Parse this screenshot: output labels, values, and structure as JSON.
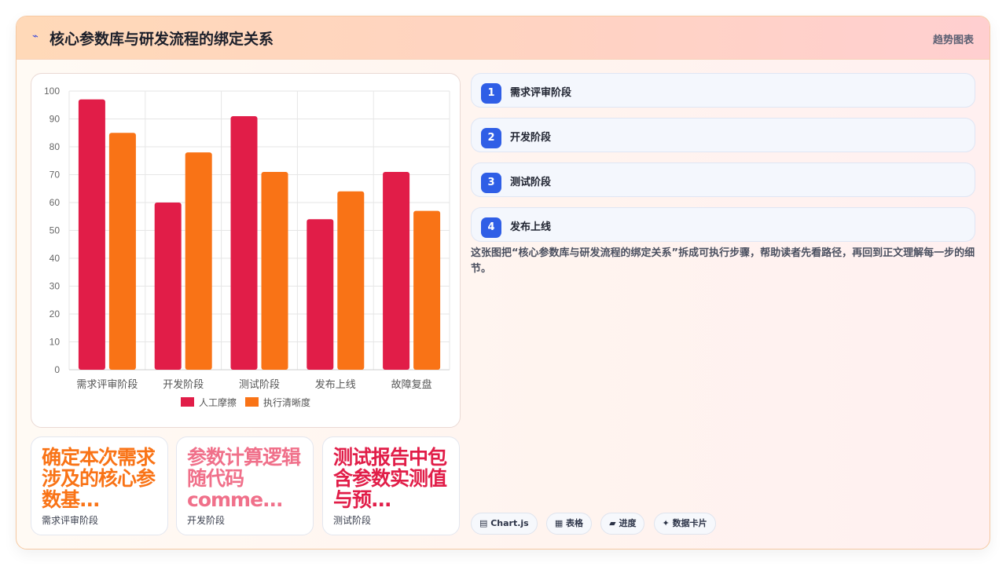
{
  "header": {
    "icon": "trend-icon",
    "title": "核心参数库与研发流程的绑定关系",
    "link_label": "趋势图表"
  },
  "chart_data": {
    "type": "bar",
    "categories": [
      "需求评审阶段",
      "开发阶段",
      "测试阶段",
      "发布上线",
      "故障复盘"
    ],
    "series": [
      {
        "name": "人工摩擦",
        "color": "#e11d48",
        "values": [
          97,
          60,
          91,
          54,
          71
        ]
      },
      {
        "name": "执行清晰度",
        "color": "#f97316",
        "values": [
          85,
          78,
          71,
          64,
          57
        ]
      }
    ],
    "ylim": [
      0,
      100
    ],
    "yticks": [
      0,
      10,
      20,
      30,
      40,
      50,
      60,
      70,
      80,
      90,
      100
    ],
    "grid": true,
    "legend_position": "bottom"
  },
  "steps": [
    {
      "num": "1",
      "label": "需求评审阶段"
    },
    {
      "num": "2",
      "label": "开发阶段"
    },
    {
      "num": "3",
      "label": "测试阶段"
    },
    {
      "num": "4",
      "label": "发布上线"
    }
  ],
  "description": "这张图把“核心参数库与研发流程的绑定关系”拆成可执行步骤，帮助读者先看路径，再回到正文理解每一步的细节。",
  "tags": [
    {
      "icon": "chart-icon",
      "label": "▤ Chart.js"
    },
    {
      "icon": "table-icon",
      "label": "▦ 表格"
    },
    {
      "icon": "progress-icon",
      "label": "▰ 进度"
    },
    {
      "icon": "data-card-icon",
      "label": "✦ 数据卡片"
    }
  ],
  "mini_cards": [
    {
      "title": "确定本次需求涉及的核心参数基...",
      "subtitle": "需求评审阶段",
      "color": "#f97316"
    },
    {
      "title": "参数计算逻辑随代码comme...",
      "subtitle": "开发阶段",
      "color": "#f0708a"
    },
    {
      "title": "测试报告中包含参数实测值与预...",
      "subtitle": "测试阶段",
      "color": "#e11d48"
    }
  ]
}
